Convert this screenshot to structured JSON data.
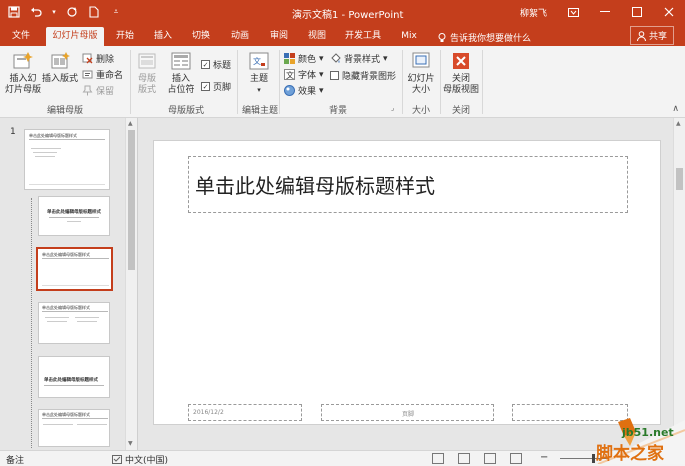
{
  "window": {
    "title": "演示文稿1 - PowerPoint",
    "user": "柳絮飞"
  },
  "quick_access": [
    "save-icon",
    "undo-icon",
    "redo-icon",
    "new-file-icon",
    "customize-icon"
  ],
  "tabs": [
    {
      "label": "文件",
      "active": false
    },
    {
      "label": "幻灯片母版",
      "active": true
    },
    {
      "label": "开始",
      "active": false
    },
    {
      "label": "插入",
      "active": false
    },
    {
      "label": "切换",
      "active": false
    },
    {
      "label": "动画",
      "active": false
    },
    {
      "label": "审阅",
      "active": false
    },
    {
      "label": "视图",
      "active": false
    },
    {
      "label": "开发工具",
      "active": false
    },
    {
      "label": "Mix",
      "active": false
    }
  ],
  "tell_me": "告诉我你想要做什么",
  "share": "共享",
  "ribbon": {
    "edit_master": {
      "group_label": "编辑母版",
      "insert_master": "插入幻\n灯片母版",
      "insert_layout": "插入版式",
      "delete": "删除",
      "rename": "重命名",
      "preserve": "保留"
    },
    "master_layout": {
      "group_label": "母版版式",
      "master_layout_btn": "母版\n版式",
      "insert_placeholder": "插入\n占位符",
      "title_check": "标题",
      "footer_check": "页脚",
      "title_checked": true,
      "footer_checked": true
    },
    "edit_theme": {
      "group_label": "编辑主题",
      "themes": "主题"
    },
    "background": {
      "group_label": "背景",
      "colors": "颜色",
      "fonts": "字体",
      "effects": "效果",
      "bg_styles": "背景样式",
      "hide_bg": "隐藏背景图形"
    },
    "size": {
      "group_label": "大小",
      "slide_size": "幻灯片\n大小"
    },
    "close": {
      "group_label": "关闭",
      "close_master": "关闭\n母版视图"
    }
  },
  "thumbnails": {
    "first_number": "1",
    "master_title": "单击此处编辑母版标题样式",
    "layout_title": "单击此处编辑母版标题样式"
  },
  "slide": {
    "title_placeholder": "单击此处编辑母版标题样式",
    "footer_date": "2016/12/2",
    "footer_center": "页脚"
  },
  "status": {
    "notes": "备注",
    "language": "中文(中国)"
  },
  "watermark": {
    "url": "jb51.net",
    "name": "脚本之家"
  },
  "colors": {
    "accent": "#c43e1c",
    "ribbon_bg": "#f3f3f3",
    "workspace_bg": "#e6e6e6"
  }
}
